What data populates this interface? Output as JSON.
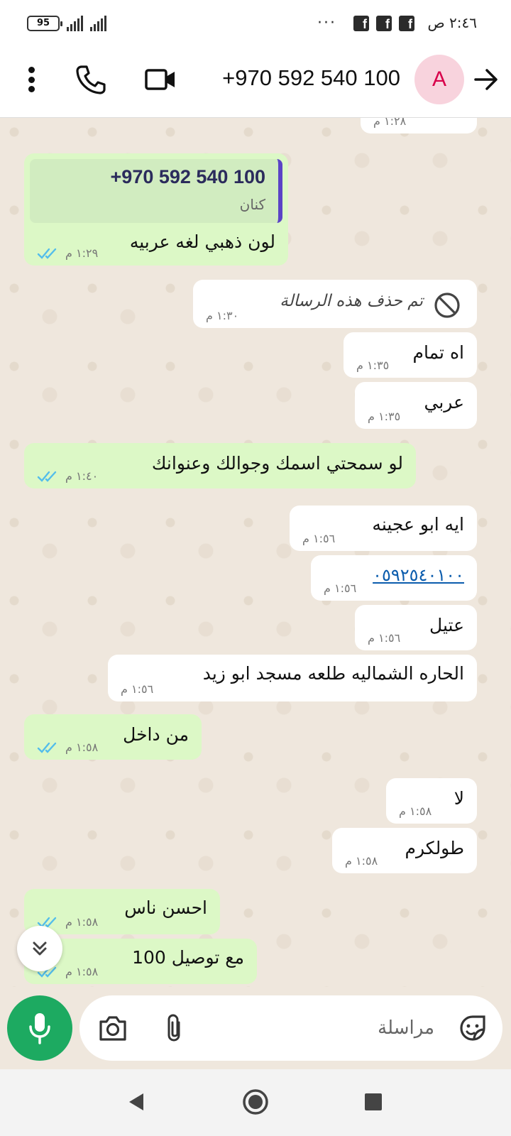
{
  "status_bar": {
    "time": "٢:٤٦ ص",
    "battery": "95",
    "more": "···",
    "notification_icons": [
      "facebook-icon",
      "facebook-icon",
      "facebook-icon"
    ]
  },
  "header": {
    "avatar_letter": "A",
    "contact_name": "+970 592 540 100"
  },
  "messages": [
    {
      "id": "m0",
      "dir": "in",
      "text": "",
      "time": "١:٢٨ م"
    },
    {
      "id": "m1",
      "dir": "out",
      "quote_phone": "+970 592 540 100",
      "quote_name": "كنان",
      "text": "لون ذهبي لغه عربيه",
      "time": "١:٢٩ م",
      "read": true
    },
    {
      "id": "m2",
      "dir": "in",
      "deleted": true,
      "text": "تم حذف هذه الرسالة",
      "time": "١:٣٠ م"
    },
    {
      "id": "m3",
      "dir": "in",
      "text": "اه تمام",
      "time": "١:٣٥ م"
    },
    {
      "id": "m4",
      "dir": "in",
      "text": "عربي",
      "time": "١:٣٥ م"
    },
    {
      "id": "m5",
      "dir": "out",
      "text": "لو سمحتي اسمك وجوالك وعنوانك",
      "time": "١:٤٠ م",
      "read": true
    },
    {
      "id": "m6",
      "dir": "in",
      "text": "ايه ابو عجينه",
      "time": "١:٥٦ م"
    },
    {
      "id": "m7",
      "dir": "in",
      "link": true,
      "text": "٠٥٩٢٥٤٠١٠٠",
      "time": "١:٥٦ م"
    },
    {
      "id": "m8",
      "dir": "in",
      "text": "عتيل",
      "time": "١:٥٦ م"
    },
    {
      "id": "m9",
      "dir": "in",
      "text": "الحاره الشماليه طلعه مسجد ابو زيد",
      "time": "١:٥٦ م"
    },
    {
      "id": "m10",
      "dir": "out",
      "text": "من داخل",
      "time": "١:٥٨ م",
      "read": true
    },
    {
      "id": "m11",
      "dir": "in",
      "text": "لا",
      "time": "١:٥٨ م"
    },
    {
      "id": "m12",
      "dir": "in",
      "text": "طولكرم",
      "time": "١:٥٨ م"
    },
    {
      "id": "m13",
      "dir": "out",
      "text": "احسن ناس",
      "time": "١:٥٨ م",
      "read": true
    },
    {
      "id": "m14",
      "dir": "out",
      "text": "مع توصيل 100",
      "time": "١:٥٨ م",
      "read": true
    }
  ],
  "composer": {
    "placeholder": "مراسلة"
  },
  "colors": {
    "outgoing_bubble": "#dcf8c6",
    "incoming_bubble": "#ffffff",
    "mic_button": "#1daa61",
    "read_ticks": "#53bdeb",
    "link": "#0b5cad",
    "quote_bar": "#5b43c6"
  }
}
